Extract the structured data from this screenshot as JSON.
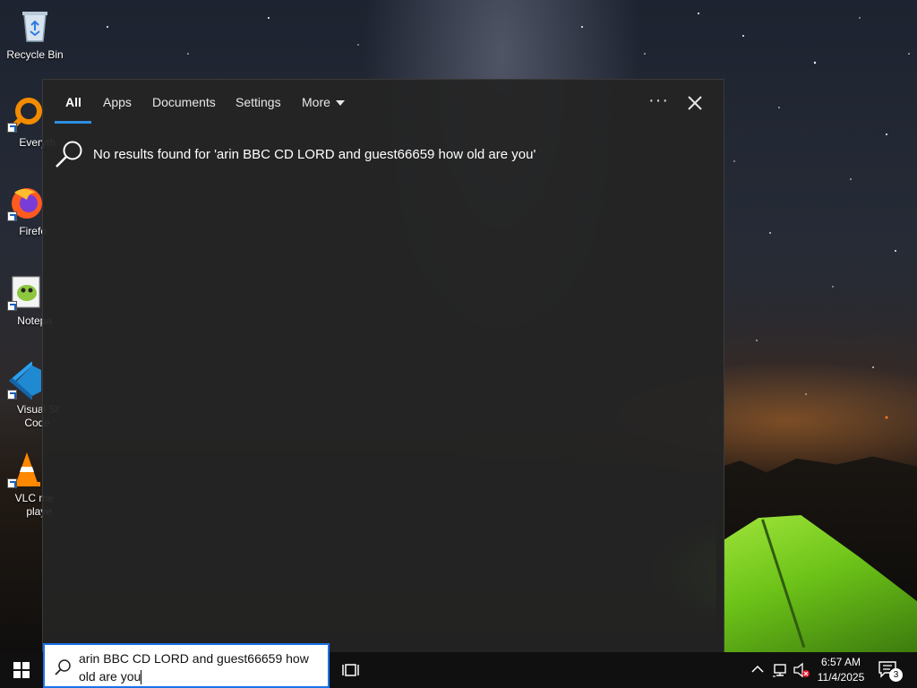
{
  "desktop": {
    "icons": [
      {
        "label": "Recycle Bin",
        "icon": "recycle-bin-icon"
      },
      {
        "label": "Everyth",
        "icon": "everything-search-icon"
      },
      {
        "label": "Firefo",
        "icon": "firefox-icon"
      },
      {
        "label": "Notepa",
        "icon": "notepad-plus-plus-icon"
      },
      {
        "label": "Visual St",
        "label2": "Code",
        "icon": "vscode-icon"
      },
      {
        "label": "VLC me",
        "label2": "playe",
        "icon": "vlc-icon"
      }
    ]
  },
  "search_panel": {
    "tabs": [
      {
        "label": "All",
        "active": true
      },
      {
        "label": "Apps"
      },
      {
        "label": "Documents"
      },
      {
        "label": "Settings"
      },
      {
        "label": "More"
      }
    ],
    "options_label": "···",
    "no_results_text": "No results found for 'arin BBC CD LORD and guest66659 how old are you'",
    "accent_color": "#2d8fe0"
  },
  "taskbar": {
    "search_query_line1": "arin BBC CD LORD and guest66659 how",
    "search_query_line2": "old are you",
    "clock_time": "6:57 AM",
    "clock_date": "11/4/2025",
    "notification_count": "3"
  }
}
